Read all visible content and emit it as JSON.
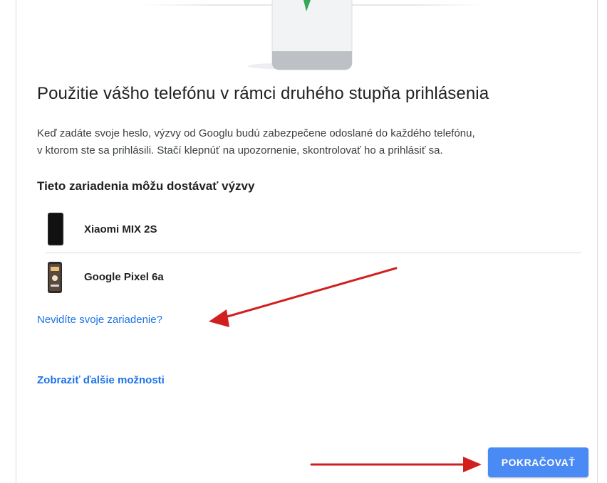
{
  "page": {
    "title": "Použitie vášho telefónu v rámci druhého stupňa prihlásenia",
    "description_line1": "Keď zadáte svoje heslo, výzvy od Googlu budú zabezpečene odoslané do každého telefónu,",
    "description_line2": "v ktorom ste sa prihlásili. Stačí klepnúť na upozornenie, skontrolovať ho a prihlásiť sa.",
    "section_heading": "Tieto zariadenia môžu dostávať výzvy"
  },
  "devices": [
    {
      "name": "Xiaomi MIX 2S",
      "icon": "phone-icon"
    },
    {
      "name": "Google Pixel 6a",
      "icon": "phone-icon"
    }
  ],
  "links": {
    "missing_device": "Nevidíte svoje zariadenie?",
    "more_options": "Zobraziť ďalšie možnosti"
  },
  "actions": {
    "continue_label": "POKRAČOVAŤ"
  },
  "colors": {
    "link": "#1a73e8",
    "button": "#4a8af4",
    "annotation_arrow": "#d11f1f"
  }
}
